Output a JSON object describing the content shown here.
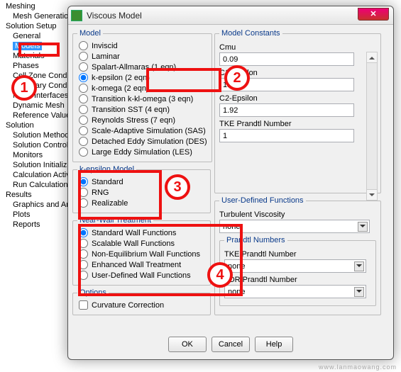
{
  "tree": {
    "meshing": "Meshing",
    "meshgen": "Mesh Generation",
    "solsetup": "Solution Setup",
    "general": "General",
    "models": "Models",
    "materials": "Materials",
    "phases": "Phases",
    "cellzone": "Cell Zone Conditions",
    "boundary": "Boundary Conditions",
    "meshiface": "Mesh Interfaces",
    "dynmesh": "Dynamic Mesh",
    "refvals": "Reference Values",
    "solution": "Solution",
    "solmeth": "Solution Methods",
    "solctrl": "Solution Controls",
    "monitors": "Monitors",
    "solinit": "Solution Initialization",
    "calcact": "Calculation Activities",
    "runcalc": "Run Calculation",
    "results": "Results",
    "graphics": "Graphics and Animations",
    "plots": "Plots",
    "reports": "Reports"
  },
  "dialog": {
    "title": "Viscous Model",
    "model_legend": "Model",
    "models": {
      "inviscid": "Inviscid",
      "laminar": "Laminar",
      "sa": "Spalart-Allmaras (1 eqn)",
      "ke": "k-epsilon (2 eqn)",
      "kw": "k-omega (2 eqn)",
      "tklo": "Transition k-kl-omega (3 eqn)",
      "tsst": "Transition SST (4 eqn)",
      "rsm": "Reynolds Stress (7 eqn)",
      "sas": "Scale-Adaptive Simulation (SAS)",
      "des": "Detached Eddy Simulation (DES)",
      "les": "Large Eddy Simulation (LES)"
    },
    "kem_legend": "k-epsilon Model",
    "kem": {
      "std": "Standard",
      "rng": "RNG",
      "rlz": "Realizable"
    },
    "nwt_legend": "Near-Wall Treatment",
    "nwt": {
      "swf": "Standard Wall Functions",
      "scwf": "Scalable Wall Functions",
      "newf": "Non-Equilibrium Wall Functions",
      "ewt": "Enhanced Wall Treatment",
      "udwf": "User-Defined Wall Functions"
    },
    "opt_legend": "Options",
    "opt": {
      "curv": "Curvature Correction"
    },
    "const_legend": "Model Constants",
    "consts": {
      "cmu_l": "Cmu",
      "cmu_v": "0.09",
      "c1e_l": "C1-Epsilon",
      "c1e_v": "1.44",
      "c2e_l": "C2-Epsilon",
      "c2e_v": "1.92",
      "tkep_l": "TKE Prandtl Number",
      "tkep_v": "1"
    },
    "udf_legend": "User-Defined Functions",
    "udf": {
      "tv_l": "Turbulent Viscosity",
      "tv_v": "none",
      "pn_l": "Prandtl Numbers",
      "tkepn_l": "TKE Prandtl Number",
      "tkepn_v": "none",
      "tdrpn_l": "TDR Prandtl Number",
      "tdrpn_v": "none"
    },
    "buttons": {
      "ok": "OK",
      "cancel": "Cancel",
      "help": "Help"
    }
  },
  "watermark": "www.lanmaowang.com"
}
